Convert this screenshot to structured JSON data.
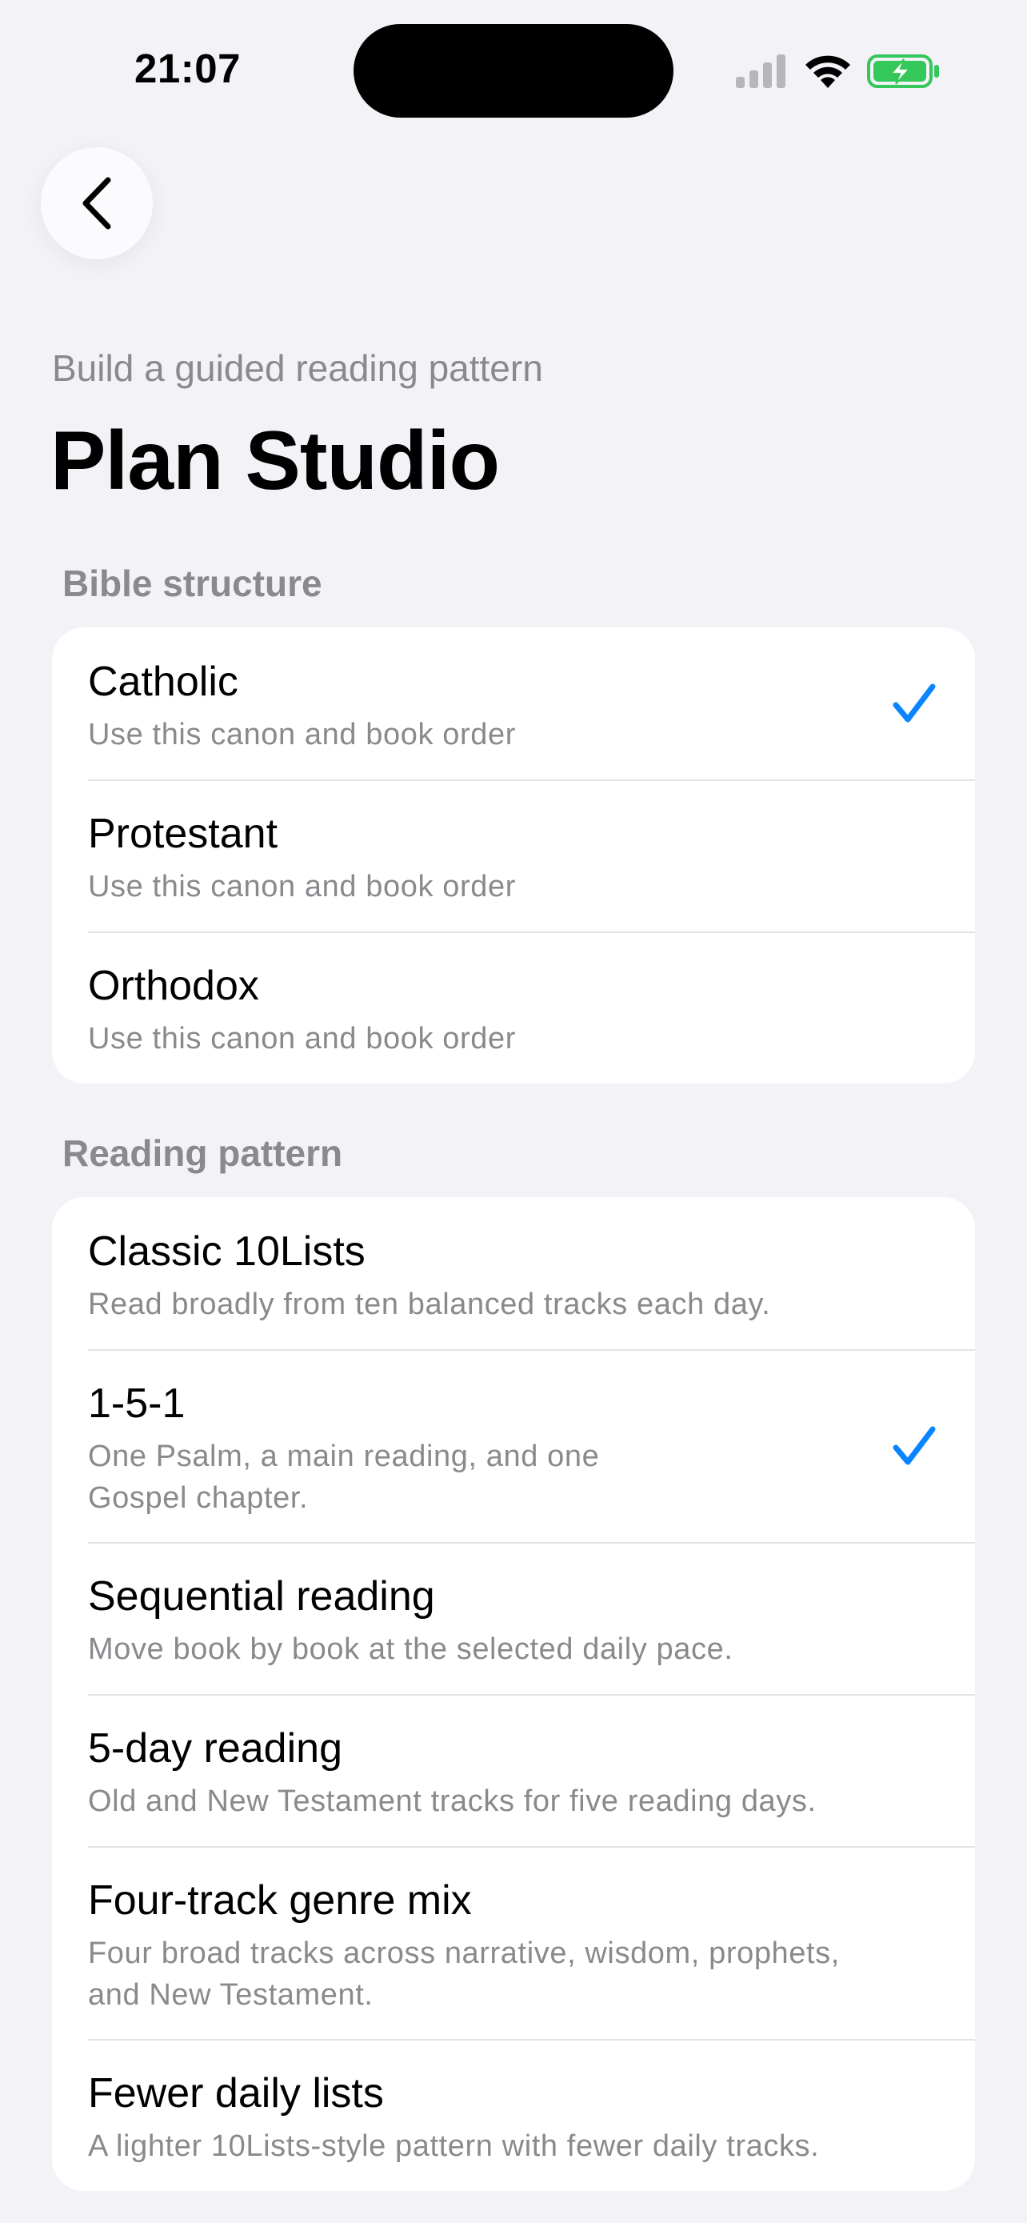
{
  "status_bar": {
    "time": "21:07"
  },
  "header": {
    "subtitle": "Build a guided reading pattern",
    "title": "Plan Studio"
  },
  "bible_structure": {
    "label": "Bible structure",
    "items": [
      {
        "title": "Catholic",
        "description": "Use this canon and book order",
        "selected": true
      },
      {
        "title": "Protestant",
        "description": "Use this canon and book order",
        "selected": false
      },
      {
        "title": "Orthodox",
        "description": "Use this canon and book order",
        "selected": false
      }
    ]
  },
  "reading_pattern": {
    "label": "Reading pattern",
    "items": [
      {
        "title": "Classic 10Lists",
        "description": "Read broadly from ten balanced tracks each day.",
        "selected": false
      },
      {
        "title": "1-5-1",
        "description_line1": "One Psalm, a main reading, and one",
        "description_line2": "Gospel chapter.",
        "selected": true
      },
      {
        "title": "Sequential reading",
        "description": "Move book by book at the selected daily pace.",
        "selected": false
      },
      {
        "title": "5-day reading",
        "description": "Old and New Testament tracks for five reading days.",
        "selected": false
      },
      {
        "title": "Four-track genre mix",
        "description_line1": "Four broad tracks across narrative, wisdom, prophets,",
        "description_line2": "and New Testament.",
        "selected": false
      },
      {
        "title": "Fewer daily lists",
        "description": "A lighter 10Lists-style pattern with fewer daily tracks.",
        "selected": false
      }
    ]
  },
  "colors": {
    "accent": "#0a84ff",
    "background": "#f2f2f7",
    "secondary_text": "#8a8a8e",
    "battery": "#34c759"
  },
  "icons": {
    "back": "chevron-left-icon",
    "check": "checkmark-icon",
    "signal": "cellular-signal-icon",
    "wifi": "wifi-icon",
    "battery": "battery-charging-icon"
  }
}
